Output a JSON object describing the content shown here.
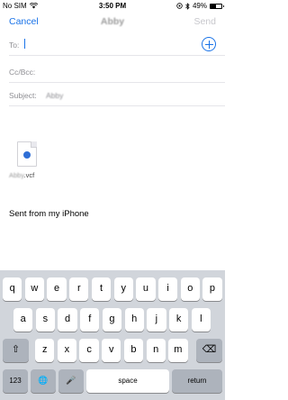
{
  "status_bar": {
    "carrier": "No SIM",
    "time": "3:50 PM",
    "battery_text": "49%",
    "battery_level": 0.49
  },
  "nav": {
    "cancel": "Cancel",
    "title": "Abby",
    "send": "Send"
  },
  "fields": {
    "to_label": "To:",
    "cc_label": "Cc/Bcc:",
    "subject_label": "Subject:",
    "subject_value": "Abby"
  },
  "attachment": {
    "name_blurred": "Abby",
    "extension": ".vcf"
  },
  "body": {
    "signature": "Sent from my iPhone"
  },
  "keyboard": {
    "row1": [
      "q",
      "w",
      "e",
      "r",
      "t",
      "y",
      "u",
      "i",
      "o",
      "p"
    ],
    "row2": [
      "a",
      "s",
      "d",
      "f",
      "g",
      "h",
      "j",
      "k",
      "l"
    ],
    "row3": [
      "z",
      "x",
      "c",
      "v",
      "b",
      "n",
      "m"
    ],
    "numbers": "123",
    "space": "space",
    "return": "return",
    "shift_glyph": "⇧",
    "delete_glyph": "⌫",
    "globe_glyph": "🌐",
    "mic_glyph": "🎤"
  },
  "colors": {
    "accent": "#1a73e8",
    "keyboard_bg": "#d1d5db",
    "special_key": "#adb3bc"
  },
  "icons": [
    "wifi-icon",
    "location-icon",
    "bluetooth-icon",
    "battery-icon",
    "add-contact-icon",
    "vcf-file-icon",
    "shift-icon",
    "delete-icon",
    "globe-icon",
    "microphone-icon"
  ]
}
